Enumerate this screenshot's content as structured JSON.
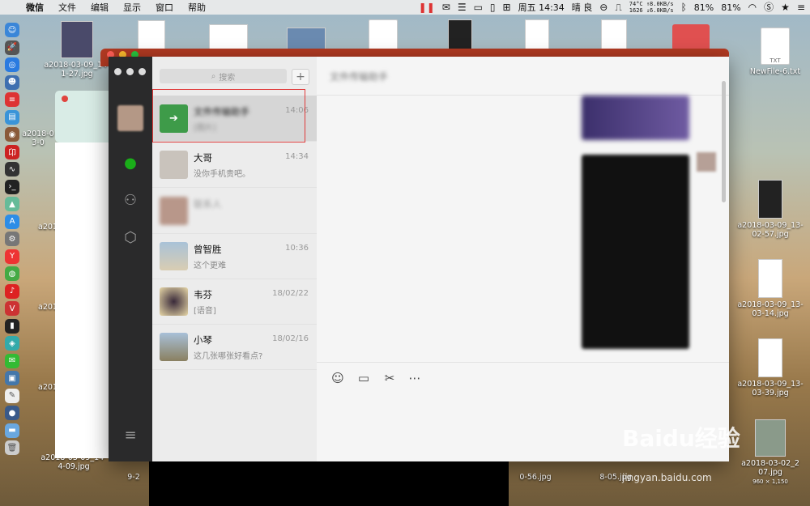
{
  "menubar": {
    "app": "微信",
    "items": [
      "文件",
      "编辑",
      "显示",
      "窗口",
      "帮助"
    ],
    "temp": "74°C",
    "cpu": "1626",
    "net_up": "↑8.0KB/s",
    "net_down": "↓6.0KB/s",
    "clock": "周五 14:34",
    "weather": "晴 良",
    "battery1": "81%",
    "battery2": "81%"
  },
  "desktop": {
    "left_icons": [
      "a2018-03-09_14-1-27.jpg",
      "a2018-0 3-0",
      "a201",
      "a201",
      "a201",
      "a2018-03-09_14-4-09.jpg"
    ],
    "right_icons": [
      "NewFile-6.txt",
      "a2018-03-09_13-02-57.jpg",
      "a2018-03-09_13-03-14.jpg",
      "a2018-03-09_13-03-39.jpg",
      "a2018-03-02_2 07.jpg"
    ],
    "right_sub": "960 × 1,150",
    "bottom_labels": [
      "9-2",
      "0-56.jpg",
      "8-05.jpg"
    ],
    "txt_label": "TXT"
  },
  "wechat": {
    "search_placeholder": "搜索",
    "plus": "+",
    "chat_title": "文件传输助手",
    "conversations": [
      {
        "name": "文件传输助手",
        "preview": "[图片]",
        "time": "14:06",
        "blurred": true
      },
      {
        "name": "大哥",
        "preview": "没你手机贵吧。",
        "time": "14:34",
        "blurred": false
      },
      {
        "name": "联系人",
        "preview": "",
        "time": "",
        "blurred": true
      },
      {
        "name": "曾智胜",
        "preview": "这个更难",
        "time": "10:36",
        "blurred": false
      },
      {
        "name": "韦芬",
        "preview": "[语音]",
        "time": "18/02/22",
        "blurred": false
      },
      {
        "name": "小琴",
        "preview": "这几张哪张好看点?",
        "time": "18/02/16",
        "blurred": false
      }
    ]
  },
  "watermark": {
    "line1": "Baidu经验",
    "line2": "jingyan.baidu.com"
  }
}
